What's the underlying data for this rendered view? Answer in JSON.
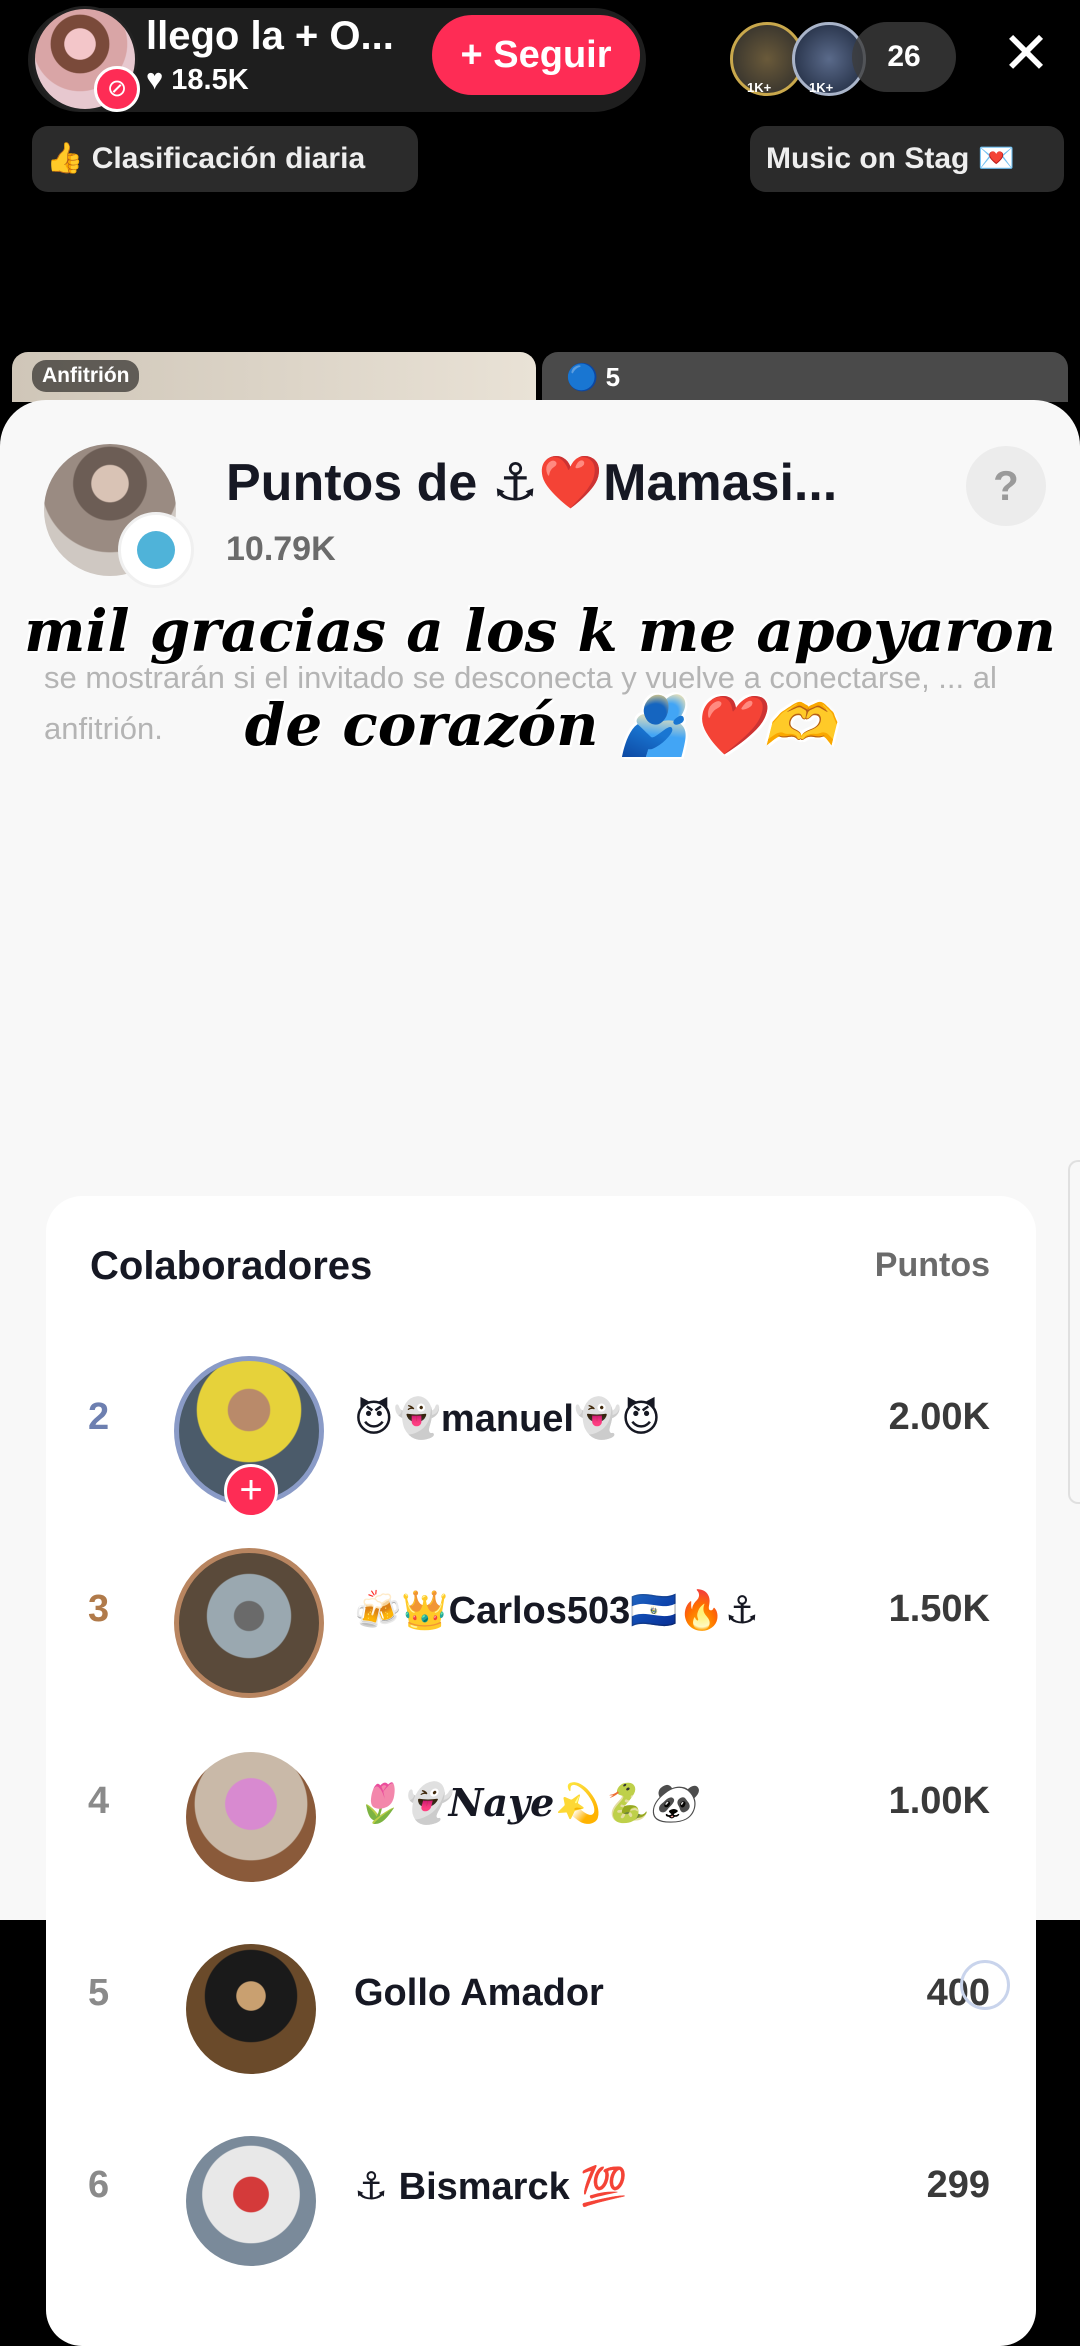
{
  "header": {
    "host_name": "llego la + O...",
    "host_likes": "♥ 18.5K",
    "follow_label": "+ Seguir",
    "viewer_tags": [
      "1K+",
      "1K+"
    ],
    "viewer_count": "26",
    "close_glyph": "✕",
    "chip_left": "👍 Clasificación diaria",
    "chip_right": "Music on Stag 💌"
  },
  "tiles": {
    "host_label": "Anfitrión",
    "guest_count": "🔵 5"
  },
  "sheet": {
    "title": "Puntos de ⚓❤️Mamasi...",
    "points": "10.79K",
    "help_glyph": "?",
    "description": "se mostrarán si el invitado se desconecta y vuelve a conectarse, ... al anfitrión.",
    "caption_line1": "mil gracias a los k me apoyaron",
    "caption_line2": "de corazón 🫂❤️🫶",
    "col_left": "Colaboradores",
    "col_right": "Puntos"
  },
  "contributors": [
    {
      "rank": "2",
      "name": "😈👻manuel👻😈",
      "points": "2.00K"
    },
    {
      "rank": "3",
      "name": "🍻👑Carlos503🇸🇻🔥⚓",
      "points": "1.50K"
    },
    {
      "rank": "4",
      "name": "🌷👻Naye💫🐍🐼",
      "points": "1.00K"
    },
    {
      "rank": "5",
      "name": "Gollo Amador",
      "points": "400"
    },
    {
      "rank": "6",
      "name": "⚓ Bismarck 💯",
      "points": "299"
    }
  ],
  "colors": {
    "accent": "#fe2c55",
    "rank2": "#6d7fb0",
    "rank3": "#b07a4a",
    "text_dark": "#161823"
  }
}
